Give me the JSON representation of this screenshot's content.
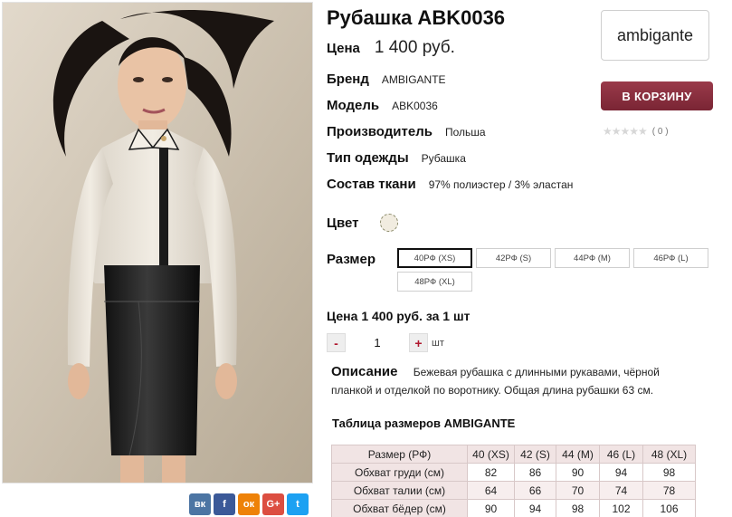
{
  "product": {
    "title": "Рубашка ABK0036",
    "price_label": "Цена",
    "price_value": "1 400 руб.",
    "properties": [
      {
        "key": "Бренд",
        "value": "AMBIGANTE"
      },
      {
        "key": "Модель",
        "value": "ABK0036"
      },
      {
        "key": "Производитель",
        "value": "Польша"
      },
      {
        "key": "Тип одежды",
        "value": "Рубашка"
      },
      {
        "key": "Состав ткани",
        "value": "97% полиэстер / 3% эластан"
      }
    ],
    "color_label": "Цвет",
    "size_label": "Размер",
    "sizes": [
      "40РФ (XS)",
      "42РФ (S)",
      "44РФ (M)",
      "46РФ (L)",
      "48РФ (XL)"
    ],
    "selected_size_index": 0,
    "total": "Цена 1 400 руб. за 1 шт",
    "quantity": "1",
    "quantity_minus": "-",
    "quantity_plus": "+",
    "quantity_unit": "шт",
    "description_label": "Описание",
    "description_text": "Бежевая рубашка с длинными рукавами, чёрной планкой и отделкой по воротнику. Общая длина рубашки 63 см."
  },
  "brand_logo_text": "ambigante",
  "cart_button": "В КОРЗИНУ",
  "rating": {
    "stars": "★★★★★",
    "filled": 0,
    "count": "( 0 )"
  },
  "social": [
    {
      "name": "vk",
      "label": "вк",
      "color": "#4c75a3"
    },
    {
      "name": "facebook",
      "label": "f",
      "color": "#3b5998"
    },
    {
      "name": "odnoklassniki",
      "label": "ок",
      "color": "#ee8208"
    },
    {
      "name": "google-plus",
      "label": "G+",
      "color": "#dc4e41"
    },
    {
      "name": "twitter",
      "label": "t",
      "color": "#1da1f2"
    }
  ],
  "size_table": {
    "title": "Таблица размеров AMBIGANTE",
    "headers": [
      "Размер (РФ)",
      "40 (XS)",
      "42 (S)",
      "44 (M)",
      "46 (L)",
      "48 (XL)"
    ],
    "rows": [
      [
        "Обхват груди (см)",
        "82",
        "86",
        "90",
        "94",
        "98"
      ],
      [
        "Обхват талии (см)",
        "64",
        "66",
        "70",
        "74",
        "78"
      ],
      [
        "Обхват бёдер (см)",
        "90",
        "94",
        "98",
        "102",
        "106"
      ]
    ]
  }
}
